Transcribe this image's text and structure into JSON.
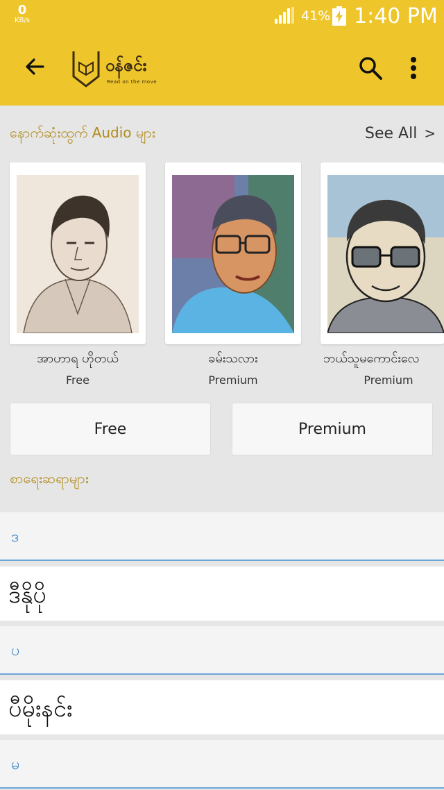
{
  "status_bar": {
    "net_speed": "0",
    "net_unit": "KB/s",
    "battery": "41%",
    "time": "1:40 PM"
  },
  "app_bar": {
    "logo_text": "ဝန်ဇင်း",
    "logo_tagline": "Read on the move",
    "icons": [
      "back-arrow-icon",
      "search-icon",
      "more-vert-icon"
    ]
  },
  "recent_audio": {
    "title": "နောက်ဆုံးထွက် Audio များ",
    "see_all": "See All",
    "cards": [
      {
        "name": "အာဟာရ ဟိုတယ်",
        "tier": "Free"
      },
      {
        "name": "ခမ်းသလား",
        "tier": "Premium"
      },
      {
        "name": "ဘယ်သူမကောင်းလေ",
        "tier": "Premium"
      }
    ]
  },
  "filter_buttons": {
    "free": "Free",
    "premium": "Premium"
  },
  "writers": {
    "title": "စာရေးဆရာများ",
    "groups": [
      {
        "letter": "ဒ",
        "name": "ဒီနိုပို"
      },
      {
        "letter": "ပ",
        "name": "ပီမိုးနင်း"
      },
      {
        "letter": "မ"
      }
    ]
  },
  "colors": {
    "app_bar": "#eec62b",
    "section_title": "#b08a1a",
    "index_letter": "#3a86c8",
    "divider": "#6ba5d8"
  }
}
